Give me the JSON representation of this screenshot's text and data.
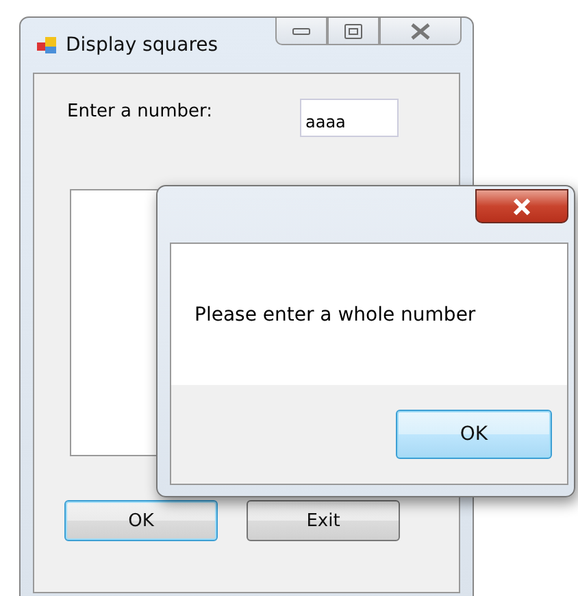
{
  "main_window": {
    "title": "Display squares",
    "label": "Enter a number:",
    "input_value": "aaaa",
    "buttons": [
      {
        "label": "OK",
        "default": true
      },
      {
        "label": "Exit",
        "default": false
      }
    ]
  },
  "dialog": {
    "message": "Please enter a whole number",
    "buttons": [
      {
        "label": "OK",
        "default": true
      }
    ]
  }
}
